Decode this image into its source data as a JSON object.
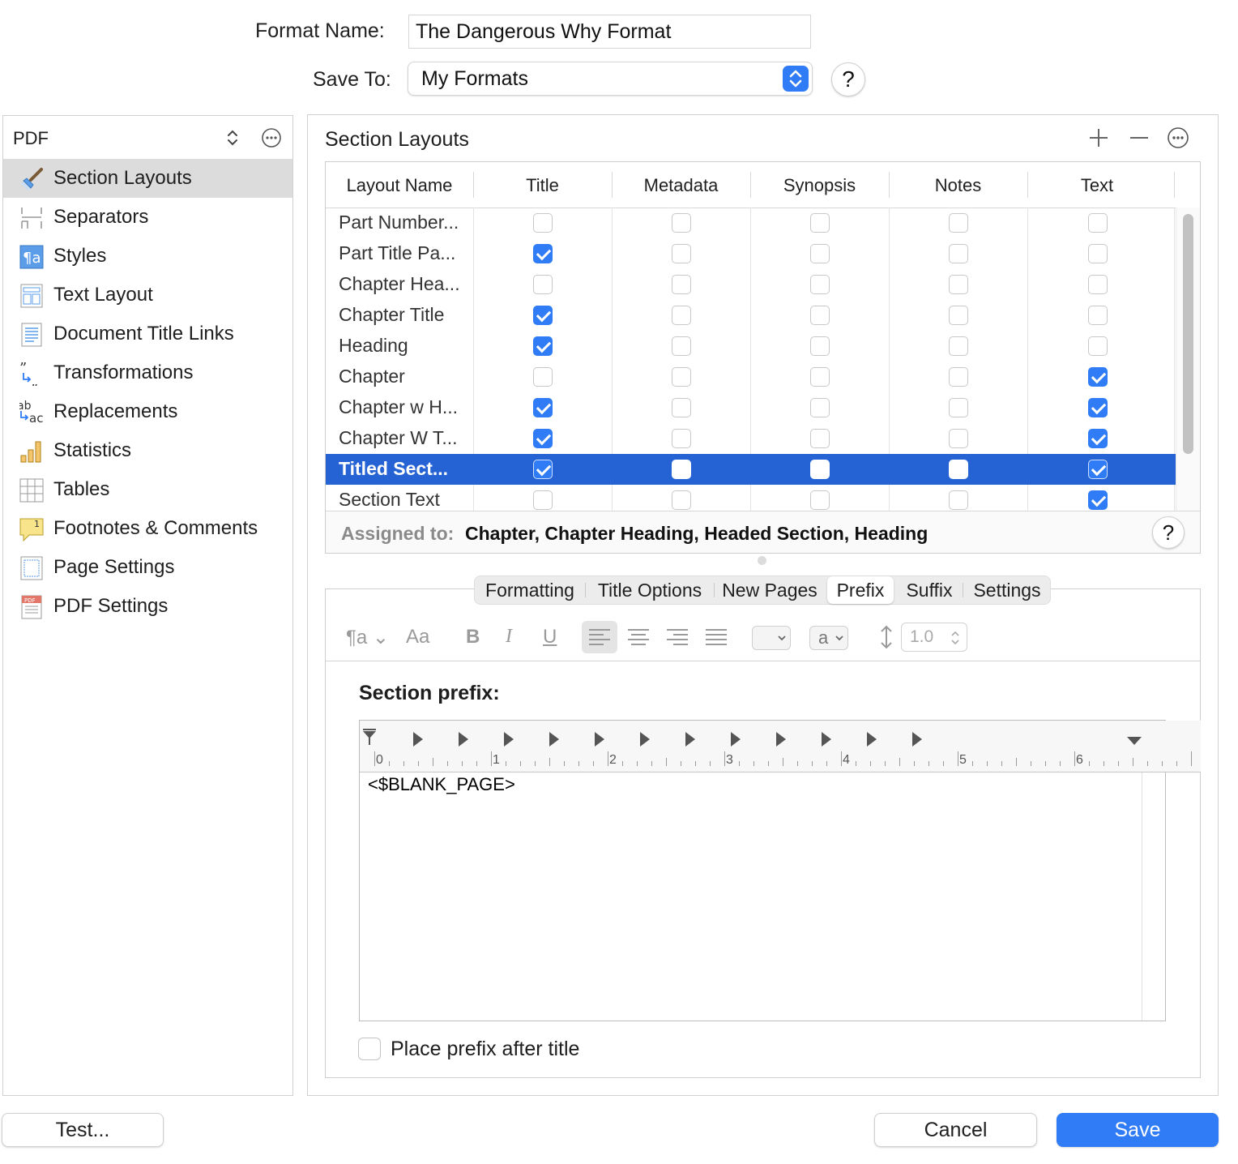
{
  "header": {
    "format_name_label": "Format Name:",
    "format_name_value": "The Dangerous Why Format",
    "save_to_label": "Save To:",
    "save_to_value": "My Formats",
    "help": "?"
  },
  "sidebar": {
    "selector": "PDF",
    "items": [
      {
        "label": "Section Layouts",
        "icon": "brush-icon",
        "active": true
      },
      {
        "label": "Separators",
        "icon": "separator-icon"
      },
      {
        "label": "Styles",
        "icon": "styles-icon"
      },
      {
        "label": "Text Layout",
        "icon": "text-layout-icon"
      },
      {
        "label": "Document Title Links",
        "icon": "document-icon"
      },
      {
        "label": "Transformations",
        "icon": "quotes-icon"
      },
      {
        "label": "Replacements",
        "icon": "replace-icon"
      },
      {
        "label": "Statistics",
        "icon": "bar-chart-icon"
      },
      {
        "label": "Tables",
        "icon": "table-icon"
      },
      {
        "label": "Footnotes & Comments",
        "icon": "footnote-icon"
      },
      {
        "label": "Page Settings",
        "icon": "page-icon"
      },
      {
        "label": "PDF Settings",
        "icon": "pdf-icon"
      }
    ]
  },
  "section_layouts": {
    "title": "Section Layouts",
    "add": "+",
    "remove": "—",
    "columns": [
      "Layout Name",
      "Title",
      "Metadata",
      "Synopsis",
      "Notes",
      "Text"
    ],
    "rows": [
      {
        "name": "Part Number...",
        "checks": [
          false,
          false,
          false,
          false,
          false
        ]
      },
      {
        "name": "Part Title Pa...",
        "checks": [
          true,
          false,
          false,
          false,
          false
        ]
      },
      {
        "name": "Chapter Hea...",
        "checks": [
          false,
          false,
          false,
          false,
          false
        ]
      },
      {
        "name": "Chapter Title",
        "checks": [
          true,
          false,
          false,
          false,
          false
        ]
      },
      {
        "name": "Heading",
        "checks": [
          true,
          false,
          false,
          false,
          false
        ]
      },
      {
        "name": "Chapter",
        "checks": [
          false,
          false,
          false,
          false,
          true
        ]
      },
      {
        "name": "Chapter w H...",
        "checks": [
          true,
          false,
          false,
          false,
          true
        ]
      },
      {
        "name": "Chapter W T...",
        "checks": [
          true,
          false,
          false,
          false,
          true
        ]
      },
      {
        "name": "Titled Sect...",
        "checks": [
          true,
          false,
          false,
          false,
          true
        ],
        "selected": true
      },
      {
        "name": "Section Text",
        "checks": [
          false,
          false,
          false,
          false,
          true
        ]
      }
    ],
    "assigned_label": "Assigned to:",
    "assigned_value": "Chapter, Chapter Heading, Headed Section, Heading"
  },
  "tabs": [
    "Formatting",
    "Title Options",
    "New Pages",
    "Prefix",
    "Suffix",
    "Settings"
  ],
  "active_tab": "Prefix",
  "toolbar": {
    "aa": "Aa",
    "bold": "B",
    "italic": "I",
    "underline": "U",
    "font_color": "a",
    "line_spacing": "1.0"
  },
  "prefix": {
    "heading": "Section prefix:",
    "ruler_numbers": [
      "0",
      "1",
      "2",
      "3",
      "4",
      "5",
      "6"
    ],
    "content": "<$BLANK_PAGE>",
    "place_after_title_label": "Place prefix after title",
    "place_after_title_checked": false
  },
  "buttons": {
    "test": "Test...",
    "cancel": "Cancel",
    "save": "Save"
  },
  "colors": {
    "accent": "#2f7cf6",
    "selection": "#2563d4"
  }
}
